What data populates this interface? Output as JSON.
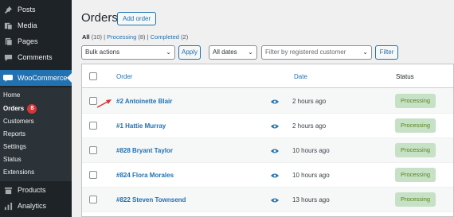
{
  "sidebar": {
    "menu": [
      {
        "label": "Posts",
        "icon": "pin-icon"
      },
      {
        "label": "Media",
        "icon": "media-icon"
      },
      {
        "label": "Pages",
        "icon": "pages-icon"
      },
      {
        "label": "Comments",
        "icon": "comments-icon"
      },
      {
        "label": "WooCommerce",
        "icon": "woocommerce-icon"
      }
    ],
    "submenu": [
      {
        "label": "Home"
      },
      {
        "label": "Orders",
        "badge": "8"
      },
      {
        "label": "Customers"
      },
      {
        "label": "Reports"
      },
      {
        "label": "Settings"
      },
      {
        "label": "Status"
      },
      {
        "label": "Extensions"
      }
    ],
    "bottom": [
      {
        "label": "Products",
        "icon": "products-icon"
      },
      {
        "label": "Analytics",
        "icon": "analytics-icon"
      }
    ]
  },
  "header": {
    "title": "Orders",
    "add_label": "Add order"
  },
  "views": {
    "all_label": "All",
    "all_count": "(10)",
    "sep1": "|",
    "processing_label": "Processing",
    "processing_count": "(8)",
    "sep2": "|",
    "completed_label": "Completed",
    "completed_count": "(2)"
  },
  "filters": {
    "bulk_actions": "Bulk actions",
    "apply": "Apply",
    "dates": "All dates",
    "customer_placeholder": "Filter by registered customer",
    "filter": "Filter"
  },
  "table": {
    "columns": {
      "order": "Order",
      "date": "Date",
      "status": "Status"
    },
    "rows": [
      {
        "order": "#2 Antoinette Blair",
        "date": "2 hours ago",
        "status": "Processing"
      },
      {
        "order": "#1 Hattie Murray",
        "date": "2 hours ago",
        "status": "Processing"
      },
      {
        "order": "#828 Bryant Taylor",
        "date": "10 hours ago",
        "status": "Processing"
      },
      {
        "order": "#824 Flora Morales",
        "date": "10 hours ago",
        "status": "Processing"
      },
      {
        "order": "#822 Steven Townsend",
        "date": "13 hours ago",
        "status": "Processing"
      }
    ]
  },
  "colors": {
    "sidebar_bg": "#1d2327",
    "accent": "#2271b1",
    "processing_bg": "#c6e1c6",
    "processing_text": "#5b841b",
    "annotation_arrow": "#d63638"
  }
}
